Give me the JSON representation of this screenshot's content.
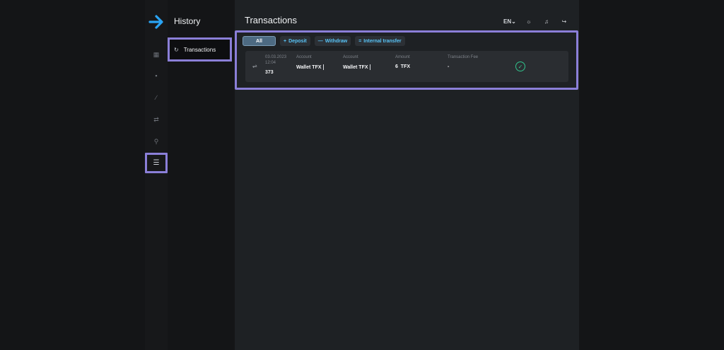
{
  "brand": {
    "accent": "#2aa4f4",
    "logo": "arrow-right-icon"
  },
  "sidebar": {
    "icons": [
      {
        "name": "dashboard-icon",
        "glyph": "▦"
      },
      {
        "name": "wallet-icon",
        "glyph": "▪"
      },
      {
        "name": "chart-icon",
        "glyph": "∕"
      },
      {
        "name": "transfer-icon",
        "glyph": "⇄"
      },
      {
        "name": "user-icon",
        "glyph": "⚲"
      },
      {
        "name": "history-icon",
        "glyph": "☰"
      }
    ]
  },
  "panel": {
    "title": "History",
    "items": [
      {
        "label": "Transactions",
        "icon": "refresh-icon"
      }
    ]
  },
  "header": {
    "title": "Transactions",
    "language": "EN",
    "theme_icon": "sun-icon",
    "bell_icon": "bell-icon",
    "logout_icon": "logout-icon"
  },
  "filters": [
    {
      "label": "All",
      "icon": ""
    },
    {
      "label": "Deposit",
      "icon": "+"
    },
    {
      "label": "Withdraw",
      "icon": "—"
    },
    {
      "label": "Internal transfer",
      "icon": "="
    }
  ],
  "transaction": {
    "date": "03.03.2023",
    "time": "12:04",
    "id": "373",
    "from_label": "Account",
    "from_value": "Wallet TFX",
    "to_label": "Account",
    "to_value": "Wallet TFX",
    "amount_label": "Amount",
    "amount_value": "6",
    "amount_currency": "TFX",
    "fee_label": "Transaction Fee",
    "fee_value": "-",
    "status_icon": "check-circle-icon"
  }
}
